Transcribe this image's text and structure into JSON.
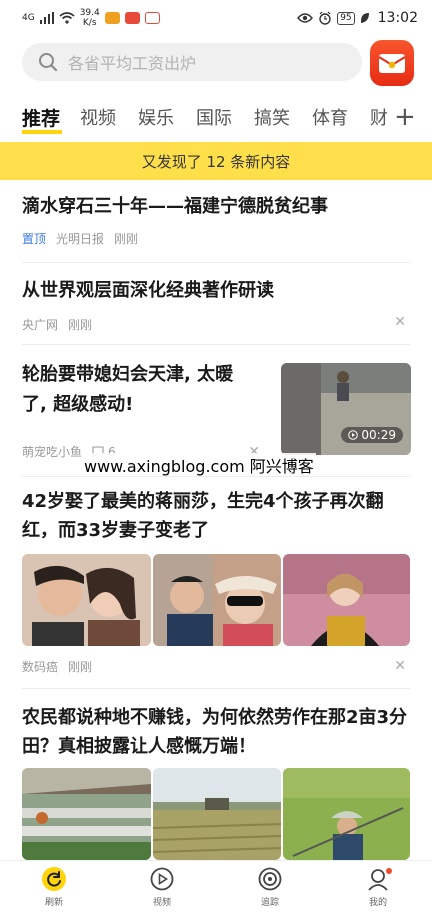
{
  "statusbar": {
    "signal": "4G",
    "speed_value": "39.4",
    "speed_unit": "K/s",
    "battery": "95",
    "time": "13:02"
  },
  "search": {
    "placeholder": "各省平均工资出炉"
  },
  "tabs": [
    "推荐",
    "视频",
    "娱乐",
    "国际",
    "搞笑",
    "体育",
    "财"
  ],
  "banner": "又发现了 12 条新内容",
  "news": [
    {
      "title": "滴水穿石三十年——福建宁德脱贫纪事",
      "badge": "置顶",
      "source": "光明日报",
      "time": "刚刚"
    },
    {
      "title": "从世界观层面深化经典著作研读",
      "source": "央广网",
      "time": "刚刚"
    },
    {
      "title": "轮胎要带媳妇会天津, 太暖了, 超级感动!",
      "source": "萌宠吃小鱼",
      "comments": "6",
      "duration": "00:29"
    },
    {
      "title": "42岁娶了最美的蒋丽莎，生完4个孩子再次翻红，而33岁妻子变老了",
      "source": "数码癌",
      "time": "刚刚"
    },
    {
      "title": "农民都说种地不赚钱，为何依然劳作在那2亩3分田？真相披露让人感慨万端！"
    }
  ],
  "watermark": "www.axingblog.com 阿兴博客",
  "nav": [
    {
      "label": "刷新",
      "icon": "refresh-icon"
    },
    {
      "label": "视频",
      "icon": "play-icon"
    },
    {
      "label": "追踪",
      "icon": "track-icon"
    },
    {
      "label": "我的",
      "icon": "profile-icon"
    }
  ],
  "colors": {
    "accent": "#ffd40a",
    "banner": "#ffe04a",
    "link": "#3a7be0",
    "red_button": "#e72c15"
  }
}
